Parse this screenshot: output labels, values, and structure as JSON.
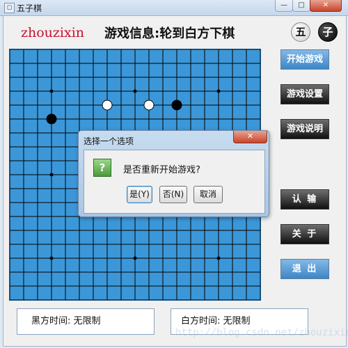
{
  "window": {
    "title": "五子棋",
    "icon_name": "app-icon",
    "min_label": "—",
    "max_label": "□",
    "close_label": "✕"
  },
  "header": {
    "author": "zhouzixin",
    "status": "游戏信息:轮到白方下棋",
    "badge_wu": "五",
    "badge_zi": "子"
  },
  "sidebar": {
    "start": "开始游戏",
    "settings": "游戏设置",
    "help": "游戏说明",
    "resign": "认  输",
    "about": "关  于",
    "exit": "退  出"
  },
  "timers": {
    "black": "黑方时间: 无限制",
    "white": "白方时间: 无限制"
  },
  "watermark": "http://blog.csdn.net/zhouzixin053",
  "board": {
    "lines": 19,
    "stones": [
      {
        "row": 4,
        "col": 7,
        "color": "white"
      },
      {
        "row": 4,
        "col": 10,
        "color": "white"
      },
      {
        "row": 4,
        "col": 12,
        "color": "black"
      },
      {
        "row": 5,
        "col": 3,
        "color": "black"
      }
    ],
    "star_points": [
      [
        3,
        3
      ],
      [
        3,
        9
      ],
      [
        3,
        15
      ],
      [
        9,
        3
      ],
      [
        9,
        9
      ],
      [
        9,
        15
      ],
      [
        15,
        3
      ],
      [
        15,
        9
      ],
      [
        15,
        15
      ]
    ],
    "colors": {
      "background": "#3c97d8",
      "line": "#000000"
    }
  },
  "dialog": {
    "title": "选择一个选项",
    "close_label": "✕",
    "icon": "question-icon",
    "message": "是否重新开始游戏?",
    "yes": "是(Y)",
    "no": "否(N)",
    "cancel": "取消"
  }
}
